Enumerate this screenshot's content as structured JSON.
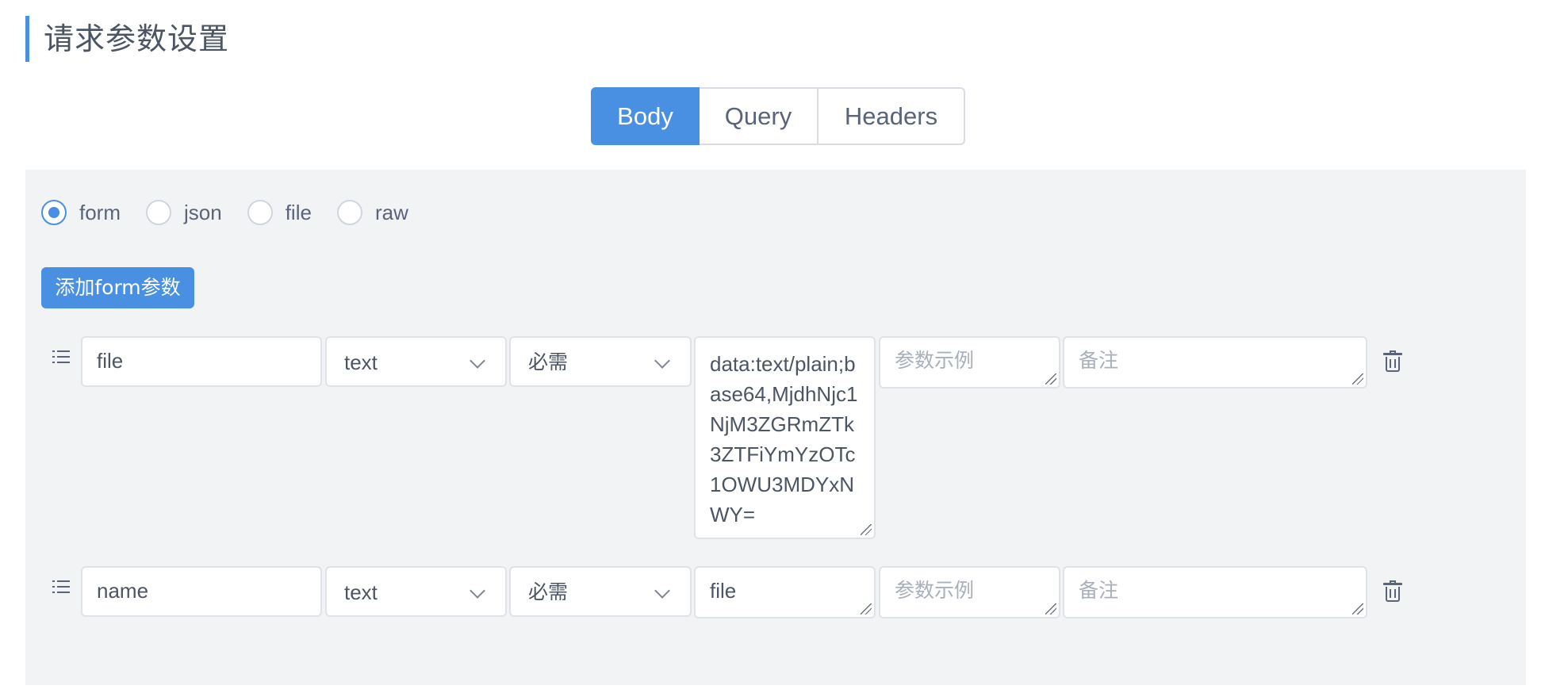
{
  "page": {
    "title": "请求参数设置"
  },
  "tabs": [
    {
      "label": "Body",
      "active": true
    },
    {
      "label": "Query",
      "active": false
    },
    {
      "label": "Headers",
      "active": false
    }
  ],
  "body_type": {
    "options": [
      {
        "label": "form",
        "checked": true
      },
      {
        "label": "json",
        "checked": false
      },
      {
        "label": "file",
        "checked": false
      },
      {
        "label": "raw",
        "checked": false
      }
    ]
  },
  "add_button": {
    "label": "添加form参数"
  },
  "params": [
    {
      "name": "file",
      "type": "text",
      "required": "必需",
      "value": "data:text/plain;base64,MjdhNjc1NjM3ZGRmZTk3ZTFiYmYzOTc1OWU3MDYxNWY=",
      "example_placeholder": "参数示例",
      "remark_placeholder": "备注"
    },
    {
      "name": "name",
      "type": "text",
      "required": "必需",
      "value": "file",
      "example_placeholder": "参数示例",
      "remark_placeholder": "备注"
    }
  ],
  "colors": {
    "accent": "#4a90e2",
    "panel_bg": "#f2f3f5",
    "text": "#4b5563",
    "placeholder": "#a8b0bb"
  },
  "icons": {
    "drag": "drag-list-icon",
    "delete": "trash-icon",
    "dropdown": "chevron-down-icon"
  }
}
